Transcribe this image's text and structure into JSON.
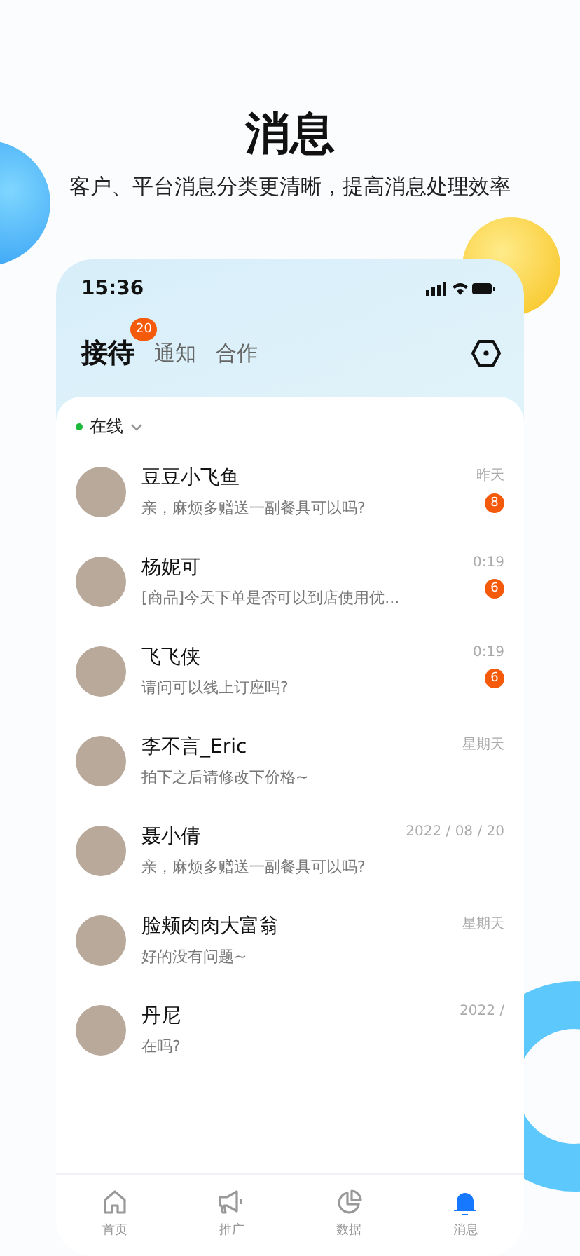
{
  "headline": {
    "title": "消息",
    "subtitle": "客户、平台消息分类更清晰，提高消息处理效率"
  },
  "status_bar": {
    "time": "15:36"
  },
  "tabs": [
    {
      "label": "接待",
      "selected": true,
      "badge": "20"
    },
    {
      "label": "通知",
      "selected": false
    },
    {
      "label": "合作",
      "selected": false
    }
  ],
  "status": {
    "label": "在线"
  },
  "conversations": [
    {
      "name": "豆豆小飞鱼",
      "message": "亲，麻烦多赠送一副餐具可以吗?",
      "time": "昨天",
      "unread": "8"
    },
    {
      "name": "杨妮可",
      "message": "[商品]今天下单是否可以到店使用优...",
      "time": "0:19",
      "unread": "6"
    },
    {
      "name": "飞飞侠",
      "message": "请问可以线上订座吗?",
      "time": "0:19",
      "unread": "6"
    },
    {
      "name": "李不言_Eric",
      "message": "拍下之后请修改下价格~",
      "time": "星期天"
    },
    {
      "name": "聂小倩",
      "message": "亲，麻烦多赠送一副餐具可以吗?",
      "time": "2022 / 08 / 20"
    },
    {
      "name": "脸颊肉肉大富翁",
      "message": "好的没有问题~",
      "time": "星期天"
    },
    {
      "name": "丹尼",
      "message": "在吗?",
      "time": "2022 /"
    }
  ],
  "bottom_nav": [
    {
      "label": "首页",
      "kind": "home",
      "selected": false
    },
    {
      "label": "推广",
      "kind": "promote",
      "selected": false
    },
    {
      "label": "数据",
      "kind": "data",
      "selected": false
    },
    {
      "label": "消息",
      "kind": "message",
      "selected": true
    }
  ]
}
